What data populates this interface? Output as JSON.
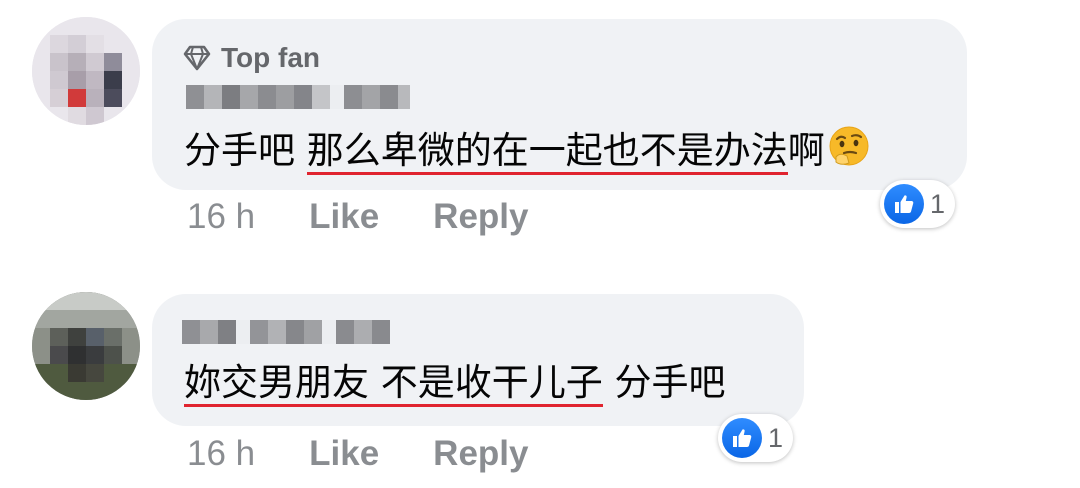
{
  "comments": [
    {
      "badge": "Top fan",
      "text_plain": "分手吧 ",
      "text_underlined": "那么卑微的在一起也不是办法",
      "text_after": "啊",
      "emoji": "thinking-face",
      "time": "16 h",
      "like_label": "Like",
      "reply_label": "Reply",
      "reaction_count": "1"
    },
    {
      "text_plain": "",
      "text_underlined": "妳交男朋友 不是收干儿子",
      "text_after": " 分手吧",
      "time": "16 h",
      "like_label": "Like",
      "reply_label": "Reply",
      "reaction_count": "1"
    }
  ],
  "colors": {
    "bubble": "#f0f2f5",
    "muted_text": "#8a8d91",
    "underline": "#e0242f",
    "like_blue": "#1877f2"
  },
  "icons": {
    "badge_icon": "diamond-icon",
    "reaction_icon": "thumbs-up-icon"
  }
}
